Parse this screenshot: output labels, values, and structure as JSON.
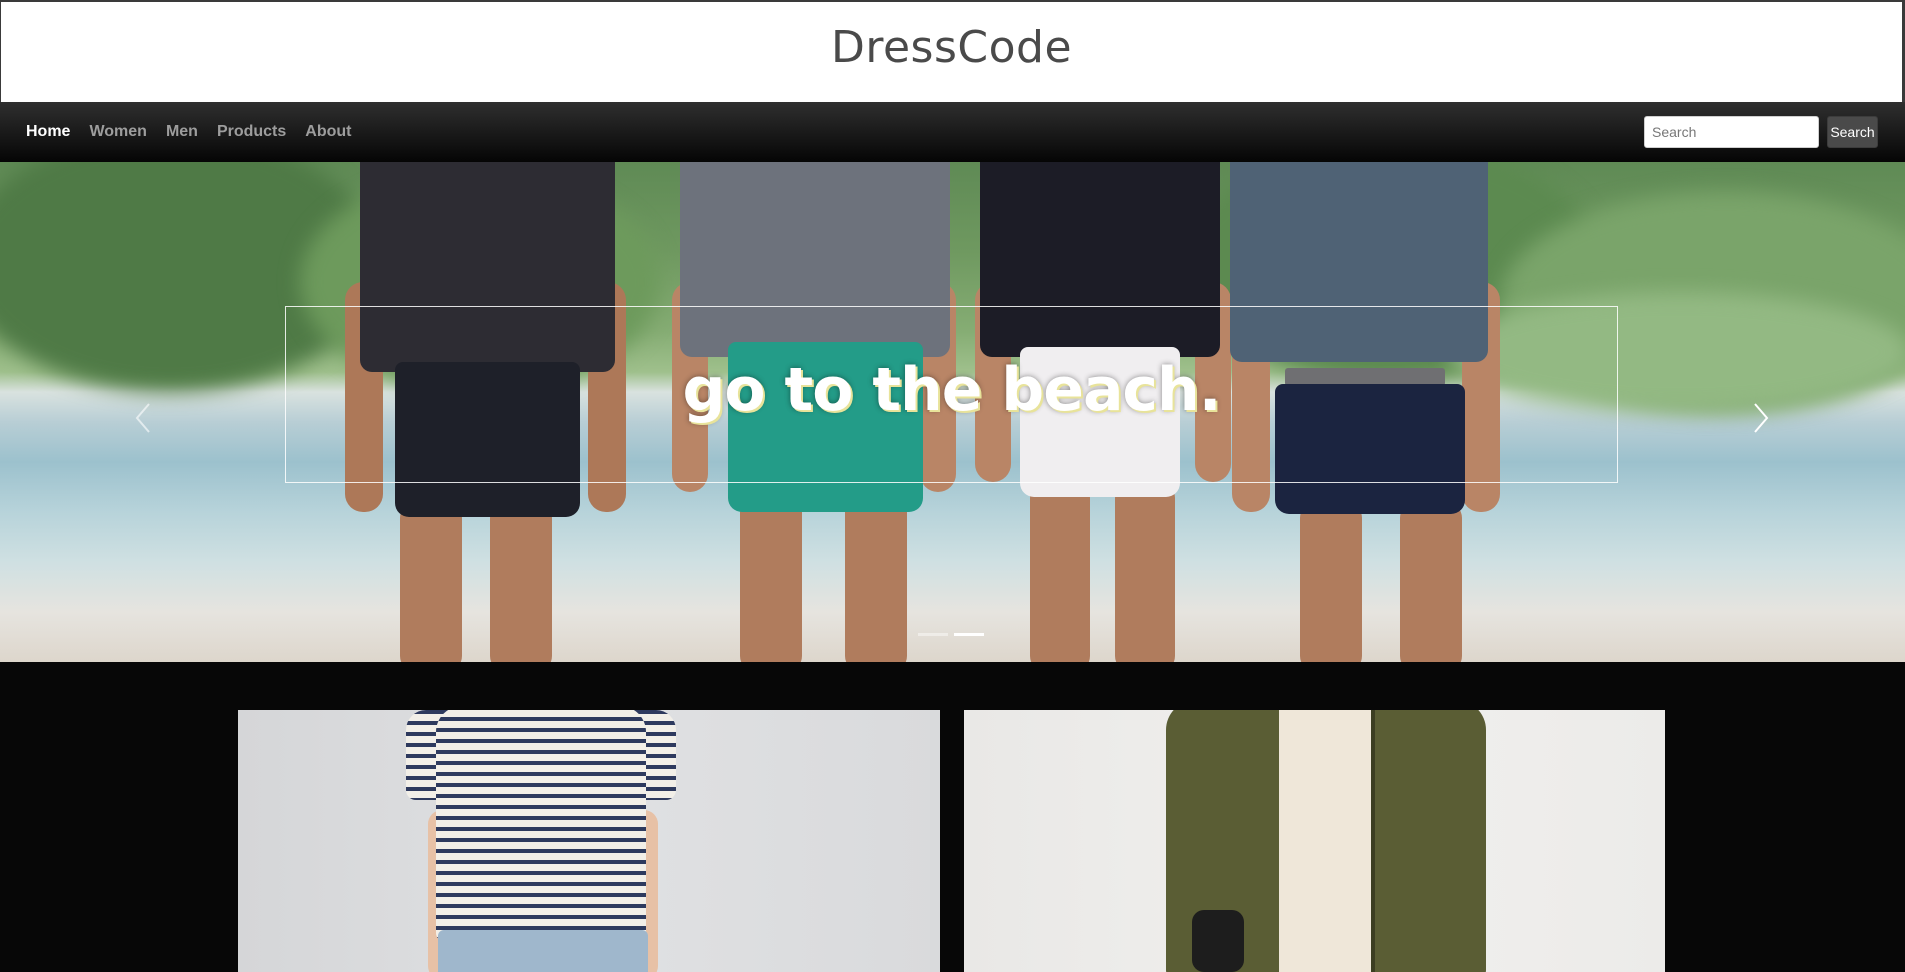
{
  "header": {
    "brand": "DressCode"
  },
  "nav": {
    "links": [
      {
        "label": "Home",
        "active": true
      },
      {
        "label": "Women",
        "active": false
      },
      {
        "label": "Men",
        "active": false
      },
      {
        "label": "Products",
        "active": false
      },
      {
        "label": "About",
        "active": false
      }
    ],
    "search": {
      "placeholder": "Search",
      "value": "",
      "button_label": "Search"
    }
  },
  "carousel": {
    "caption": "go to the beach.",
    "prev_icon": "chevron-left-icon",
    "next_icon": "chevron-right-icon",
    "slide_count": 2,
    "active_slide": 2
  },
  "products": {
    "tiles": [
      {
        "subject": "striped-top-photo"
      },
      {
        "subject": "olive-bomber-jacket-photo"
      }
    ]
  },
  "colors": {
    "header_bg": "#ffffff",
    "brand_text": "#4a4a4a",
    "navbar_bg": "#121212",
    "nav_text": "#9d9d9d",
    "nav_active": "#ffffff",
    "page_bg": "#070707",
    "search_button_bg": "#4a4a4a"
  }
}
